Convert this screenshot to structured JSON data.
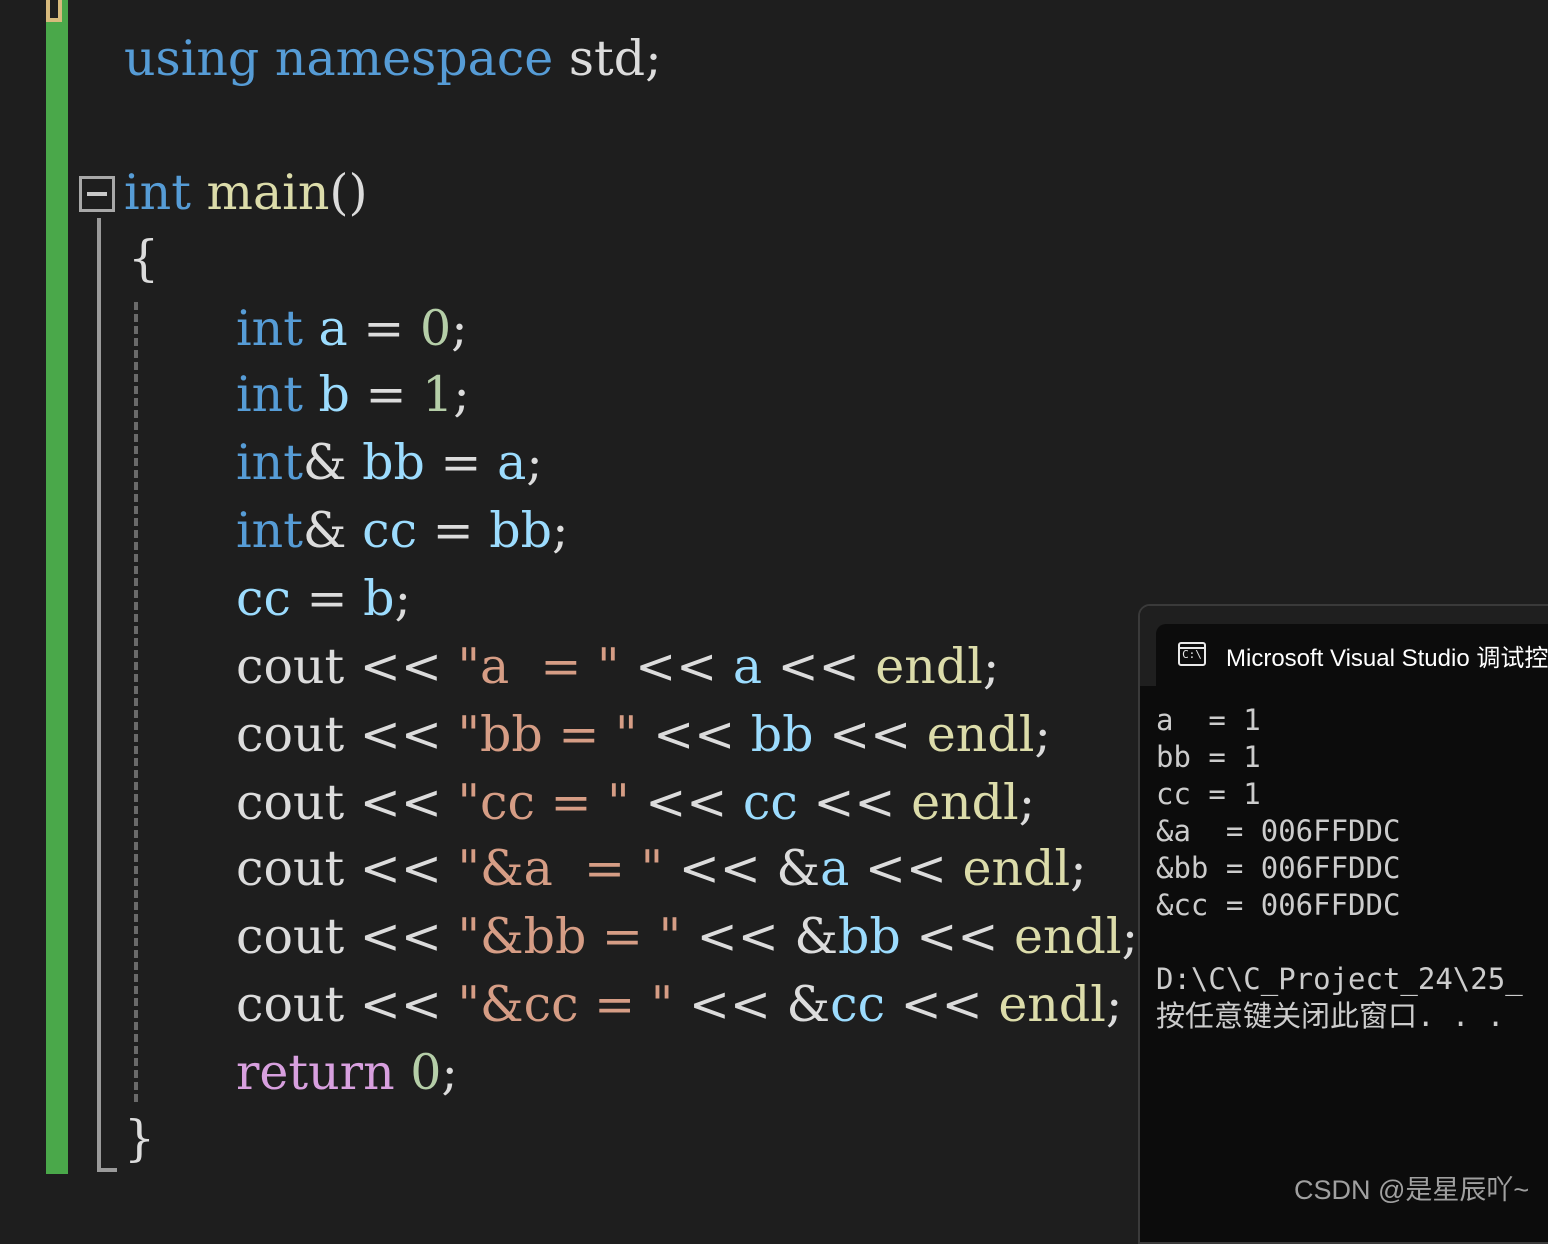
{
  "editor": {
    "lines": [
      [
        {
          "t": "using",
          "c": "kw"
        },
        {
          "t": " ",
          "c": "txt"
        },
        {
          "t": "namespace",
          "c": "kw"
        },
        {
          "t": " std;",
          "c": "txt"
        }
      ],
      [],
      [
        {
          "t": "int",
          "c": "kw"
        },
        {
          "t": " ",
          "c": "txt"
        },
        {
          "t": "main",
          "c": "fn"
        },
        {
          "t": "()",
          "c": "txt"
        }
      ],
      [
        {
          "t": "{",
          "c": "txt"
        }
      ],
      [
        {
          "t": "int",
          "c": "kw"
        },
        {
          "t": " ",
          "c": "txt"
        },
        {
          "t": "a",
          "c": "var"
        },
        {
          "t": " = ",
          "c": "txt"
        },
        {
          "t": "0",
          "c": "num"
        },
        {
          "t": ";",
          "c": "txt"
        }
      ],
      [
        {
          "t": "int",
          "c": "kw"
        },
        {
          "t": " ",
          "c": "txt"
        },
        {
          "t": "b",
          "c": "var"
        },
        {
          "t": " = ",
          "c": "txt"
        },
        {
          "t": "1",
          "c": "num"
        },
        {
          "t": ";",
          "c": "txt"
        }
      ],
      [
        {
          "t": "int",
          "c": "kw"
        },
        {
          "t": "& ",
          "c": "txt"
        },
        {
          "t": "bb",
          "c": "var"
        },
        {
          "t": " = ",
          "c": "txt"
        },
        {
          "t": "a",
          "c": "var"
        },
        {
          "t": ";",
          "c": "txt"
        }
      ],
      [
        {
          "t": "int",
          "c": "kw"
        },
        {
          "t": "& ",
          "c": "txt"
        },
        {
          "t": "cc",
          "c": "var"
        },
        {
          "t": " = ",
          "c": "txt"
        },
        {
          "t": "bb",
          "c": "var"
        },
        {
          "t": ";",
          "c": "txt"
        }
      ],
      [
        {
          "t": "cc",
          "c": "var"
        },
        {
          "t": " = ",
          "c": "txt"
        },
        {
          "t": "b",
          "c": "var"
        },
        {
          "t": ";",
          "c": "txt"
        }
      ],
      [
        {
          "t": "cout << ",
          "c": "txt"
        },
        {
          "t": "\"a  = \"",
          "c": "str"
        },
        {
          "t": " << ",
          "c": "txt"
        },
        {
          "t": "a",
          "c": "var"
        },
        {
          "t": " << ",
          "c": "txt"
        },
        {
          "t": "endl",
          "c": "fn"
        },
        {
          "t": ";",
          "c": "txt"
        }
      ],
      [
        {
          "t": "cout << ",
          "c": "txt"
        },
        {
          "t": "\"bb = \"",
          "c": "str"
        },
        {
          "t": " << ",
          "c": "txt"
        },
        {
          "t": "bb",
          "c": "var"
        },
        {
          "t": " << ",
          "c": "txt"
        },
        {
          "t": "endl",
          "c": "fn"
        },
        {
          "t": ";",
          "c": "txt"
        }
      ],
      [
        {
          "t": "cout << ",
          "c": "txt"
        },
        {
          "t": "\"cc = \"",
          "c": "str"
        },
        {
          "t": " << ",
          "c": "txt"
        },
        {
          "t": "cc",
          "c": "var"
        },
        {
          "t": " << ",
          "c": "txt"
        },
        {
          "t": "endl",
          "c": "fn"
        },
        {
          "t": ";",
          "c": "txt"
        }
      ],
      [
        {
          "t": "cout << ",
          "c": "txt"
        },
        {
          "t": "\"&a  = \"",
          "c": "str"
        },
        {
          "t": " << &",
          "c": "txt"
        },
        {
          "t": "a",
          "c": "var"
        },
        {
          "t": " << ",
          "c": "txt"
        },
        {
          "t": "endl",
          "c": "fn"
        },
        {
          "t": ";",
          "c": "txt"
        }
      ],
      [
        {
          "t": "cout << ",
          "c": "txt"
        },
        {
          "t": "\"&bb = \"",
          "c": "str"
        },
        {
          "t": " << &",
          "c": "txt"
        },
        {
          "t": "bb",
          "c": "var"
        },
        {
          "t": " << ",
          "c": "txt"
        },
        {
          "t": "endl",
          "c": "fn"
        },
        {
          "t": ";",
          "c": "txt"
        }
      ],
      [
        {
          "t": "cout << ",
          "c": "txt"
        },
        {
          "t": "\"&cc = \"",
          "c": "str"
        },
        {
          "t": " << &",
          "c": "txt"
        },
        {
          "t": "cc",
          "c": "var"
        },
        {
          "t": " << ",
          "c": "txt"
        },
        {
          "t": "endl",
          "c": "fn"
        },
        {
          "t": ";",
          "c": "txt"
        }
      ],
      [
        {
          "t": "return",
          "c": "ret"
        },
        {
          "t": " ",
          "c": "txt"
        },
        {
          "t": "0",
          "c": "num"
        },
        {
          "t": ";",
          "c": "txt"
        }
      ],
      [
        {
          "t": "}",
          "c": "txt"
        }
      ]
    ]
  },
  "console": {
    "title": "Microsoft Visual Studio 调试控制台",
    "icon": "console-icon",
    "icon_text": "C:\\",
    "output": [
      "a  = 1",
      "bb = 1",
      "cc = 1",
      "&a  = 006FFDDC",
      "&bb = 006FFDDC",
      "&cc = 006FFDDC",
      "",
      "D:\\C\\C_Project_24\\25_",
      "按任意键关闭此窗口. . ."
    ]
  },
  "watermark": "CSDN @是星辰吖~",
  "colors": {
    "background": "#1e1e1e",
    "keyword": "#569cd6",
    "variable": "#9cdcfe",
    "number": "#b5cea8",
    "function": "#dcdcaa",
    "string": "#d69d85",
    "control": "#d8a0df",
    "change_bar": "#4aa84a"
  }
}
